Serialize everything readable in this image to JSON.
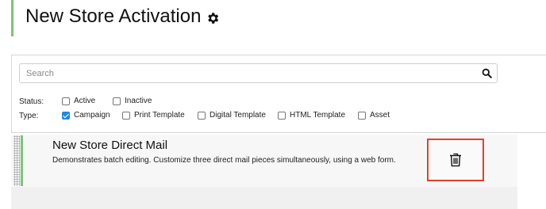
{
  "header": {
    "title": "New Store Activation",
    "settings_icon": "gear-icon",
    "accent_color": "#7cc47a"
  },
  "search": {
    "placeholder": "Search",
    "value": "",
    "icon": "search-icon"
  },
  "filters": {
    "status": {
      "label": "Status:",
      "options": [
        {
          "label": "Active",
          "checked": false
        },
        {
          "label": "Inactive",
          "checked": false
        }
      ]
    },
    "type": {
      "label": "Type:",
      "options": [
        {
          "label": "Campaign",
          "checked": true
        },
        {
          "label": "Print Template",
          "checked": false
        },
        {
          "label": "Digital Template",
          "checked": false
        },
        {
          "label": "HTML Template",
          "checked": false
        },
        {
          "label": "Asset",
          "checked": false
        }
      ]
    },
    "checkbox_color": "#1e88e5"
  },
  "results": [
    {
      "title": "New Store Direct Mail",
      "description": "Demonstrates batch editing. Customize three direct mail pieces simultaneously, using a web form.",
      "delete_icon": "trash-icon",
      "highlight_color": "#e0432d"
    }
  ]
}
